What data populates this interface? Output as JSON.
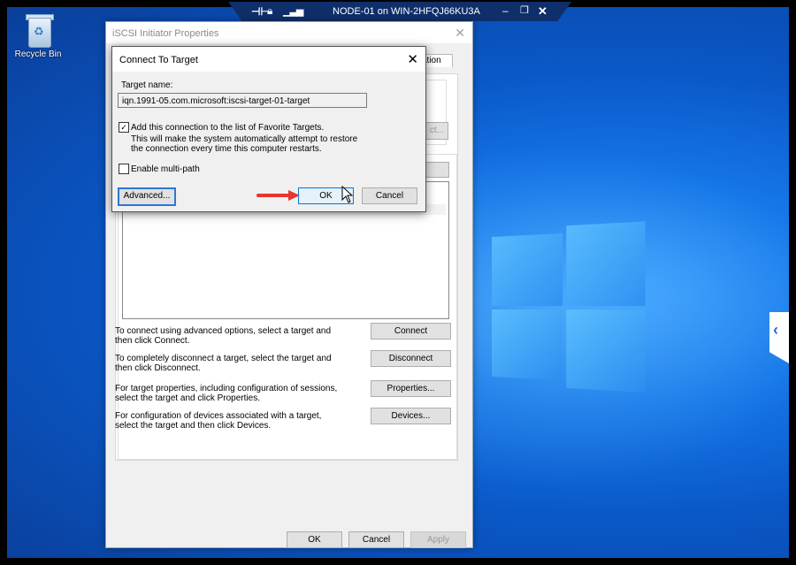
{
  "rdp": {
    "title": "NODE-01 on WIN-2HFQJ66KU3A",
    "pin_icon": "pin-icon",
    "lock_icon": "lock-icon",
    "signal_icon": "signal-icon",
    "minimize_glyph": "–",
    "restore_glyph": "❐",
    "close_glyph": "✕"
  },
  "desktop": {
    "recycle_bin_label": "Recycle Bin"
  },
  "iscsi_window": {
    "title": "iSCSI Initiator Properties",
    "close_glyph": "✕",
    "tab_fragment": "ation",
    "button_fragment": "ct...",
    "rows": [
      {
        "text": "To connect using advanced options, select a target and then click Connect.",
        "button": "Connect"
      },
      {
        "text": "To completely disconnect a target, select the target and then click Disconnect.",
        "button": "Disconnect"
      },
      {
        "text": "For target properties, including configuration of sessions, select the target and click Properties.",
        "button": "Properties..."
      },
      {
        "text": "For configuration of devices associated with a target, select the target and then click Devices.",
        "button": "Devices..."
      }
    ],
    "ok_label": "OK",
    "cancel_label": "Cancel",
    "apply_label": "Apply"
  },
  "connect_dialog": {
    "title": "Connect To Target",
    "close_glyph": "✕",
    "target_name_label": "Target name:",
    "target_name_value": "iqn.1991-05.com.microsoft:iscsi-target-01-target",
    "favorite_checked": true,
    "favorite_label": "Add this connection to the list of Favorite Targets.",
    "favorite_desc": "This will make the system automatically attempt to restore the connection every time this computer restarts.",
    "multipath_checked": false,
    "multipath_label": "Enable multi-path",
    "check_glyph": "✓",
    "advanced_label": "Advanced...",
    "ok_label": "OK",
    "cancel_label": "Cancel"
  },
  "colors": {
    "annotation_arrow": "#e8352e",
    "focus_blue": "#0078d7"
  }
}
